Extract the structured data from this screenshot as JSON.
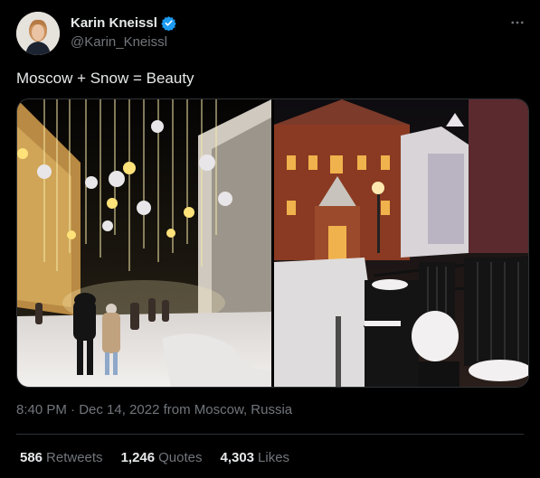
{
  "author": {
    "name": "Karin Kneissl",
    "handle": "@Karin_Kneissl",
    "verified_color": "#1d9bf0"
  },
  "tweet": {
    "text": "Moscow + Snow = Beauty",
    "time": "8:40 PM",
    "separator": "·",
    "date": "Dec 14, 2022 from Moscow, Russia"
  },
  "stats": {
    "retweets_num": "586",
    "retweets_label": "Retweets",
    "quotes_num": "1,246",
    "quotes_label": "Quotes",
    "likes_num": "4,303",
    "likes_label": "Likes"
  },
  "icons": {
    "more": "more-horizontal-icon",
    "verified": "verified-badge-icon"
  },
  "colors": {
    "background": "#000000",
    "text": "#e7e9ea",
    "muted": "#71767b",
    "border": "#2f3336"
  }
}
